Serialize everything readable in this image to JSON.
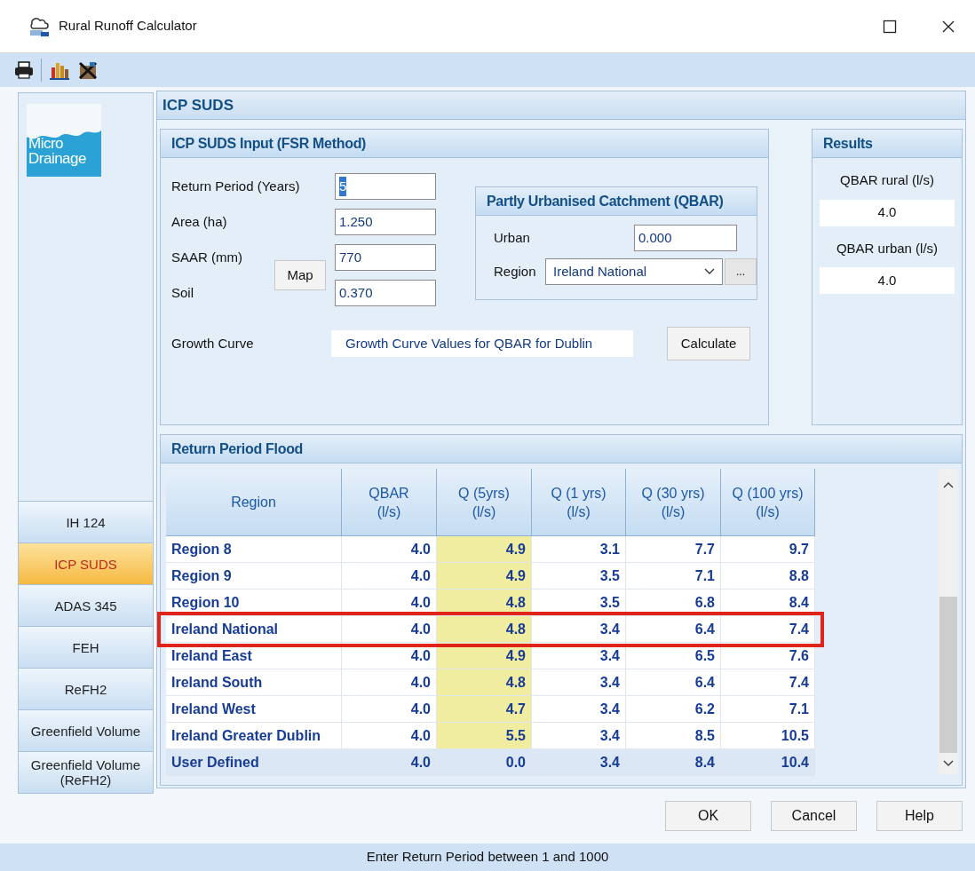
{
  "window": {
    "title": "Rural Runoff Calculator"
  },
  "sidebar": {
    "items": [
      {
        "label": "IH 124",
        "selected": false
      },
      {
        "label": "ICP SUDS",
        "selected": true
      },
      {
        "label": "ADAS 345",
        "selected": false
      },
      {
        "label": "FEH",
        "selected": false
      },
      {
        "label": "ReFH2",
        "selected": false
      },
      {
        "label": "Greenfield Volume",
        "selected": false
      },
      {
        "label": "Greenfield Volume (ReFH2)",
        "selected": false
      }
    ]
  },
  "logo": {
    "lines": [
      "Micro",
      "Drainage"
    ]
  },
  "panel_title": "ICP SUDS",
  "input_group": {
    "title": "ICP SUDS Input (FSR Method)",
    "fields": [
      {
        "label": "Return Period (Years)",
        "value": "5",
        "text_selected": true
      },
      {
        "label": "Area (ha)",
        "value": "1.250",
        "text_selected": false
      },
      {
        "label": "SAAR (mm)",
        "value": "770",
        "text_selected": false
      },
      {
        "label": "Soil",
        "value": "0.370",
        "text_selected": false
      }
    ],
    "map_button": "Map",
    "growth_curve": {
      "label": "Growth Curve",
      "value": "Growth Curve Values for QBAR for Dublin"
    },
    "calculate_button": "Calculate"
  },
  "catchment": {
    "title": "Partly Urbanised Catchment (QBAR)",
    "urban": {
      "label": "Urban",
      "value": "0.000"
    },
    "region": {
      "label": "Region",
      "value": "Ireland National"
    },
    "more_button": "..."
  },
  "results": {
    "title": "Results",
    "fields": [
      {
        "label": "QBAR rural (l/s)",
        "value": "4.0"
      },
      {
        "label": "QBAR urban (l/s)",
        "value": "4.0"
      }
    ]
  },
  "table": {
    "title": "Return Period Flood",
    "columns": [
      {
        "lines": [
          "Region"
        ],
        "highlighted": false
      },
      {
        "lines": [
          "QBAR",
          "(l/s)"
        ],
        "highlighted": false
      },
      {
        "lines": [
          "Q (5yrs)",
          "(l/s)"
        ],
        "highlighted": true
      },
      {
        "lines": [
          "Q (1 yrs)",
          "(l/s)"
        ],
        "highlighted": false
      },
      {
        "lines": [
          "Q (30 yrs)",
          "(l/s)"
        ],
        "highlighted": false
      },
      {
        "lines": [
          "Q (100 yrs)",
          "(l/s)"
        ],
        "highlighted": false
      }
    ],
    "rows": [
      {
        "kind": "region",
        "highlighted": false,
        "cells": [
          "Region 8",
          "4.0",
          "4.9",
          "3.1",
          "7.7",
          "9.7"
        ]
      },
      {
        "kind": "region",
        "highlighted": false,
        "cells": [
          "Region 9",
          "4.0",
          "4.9",
          "3.5",
          "7.1",
          "8.8"
        ]
      },
      {
        "kind": "region",
        "highlighted": false,
        "cells": [
          "Region 10",
          "4.0",
          "4.8",
          "3.5",
          "6.8",
          "8.4"
        ]
      },
      {
        "kind": "region",
        "highlighted": true,
        "cells": [
          "Ireland National",
          "4.0",
          "4.8",
          "3.4",
          "6.4",
          "7.4"
        ]
      },
      {
        "kind": "region",
        "highlighted": false,
        "cells": [
          "Ireland East",
          "4.0",
          "4.9",
          "3.4",
          "6.5",
          "7.6"
        ]
      },
      {
        "kind": "region",
        "highlighted": false,
        "cells": [
          "Ireland South",
          "4.0",
          "4.8",
          "3.4",
          "6.4",
          "7.4"
        ]
      },
      {
        "kind": "region",
        "highlighted": false,
        "cells": [
          "Ireland West",
          "4.0",
          "4.7",
          "3.4",
          "6.2",
          "7.1"
        ]
      },
      {
        "kind": "region",
        "highlighted": false,
        "cells": [
          "Ireland Greater Dublin",
          "4.0",
          "5.5",
          "3.4",
          "8.5",
          "10.5"
        ]
      },
      {
        "kind": "user",
        "highlighted": false,
        "cells": [
          "User Defined",
          "4.0",
          "0.0",
          "3.4",
          "8.4",
          "10.4"
        ]
      }
    ]
  },
  "buttons": [
    "OK",
    "Cancel",
    "Help"
  ],
  "status_bar": "Enter Return Period between 1 and 1000"
}
